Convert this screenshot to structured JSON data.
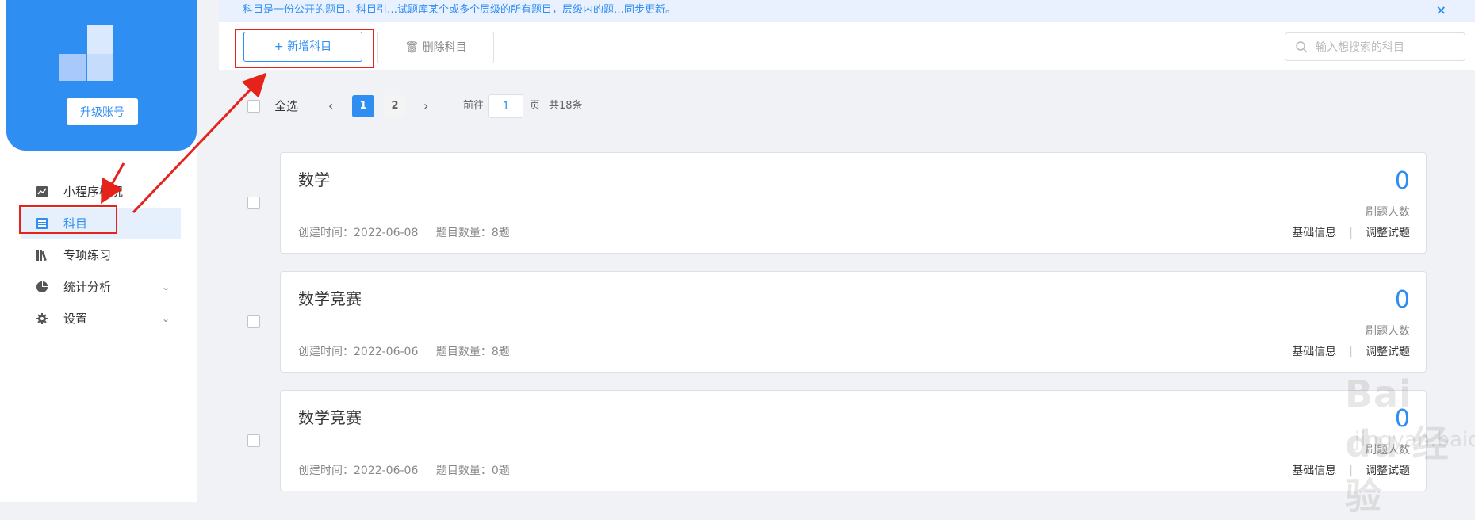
{
  "sidebar": {
    "upgrade_label": "升级账号",
    "menu": [
      {
        "label": "小程序概况",
        "icon": "trend-chart-icon"
      },
      {
        "label": "科目",
        "icon": "list-icon"
      },
      {
        "label": "专项练习",
        "icon": "books-icon"
      },
      {
        "label": "统计分析",
        "icon": "pie-chart-icon"
      },
      {
        "label": "设置",
        "icon": "gear-icon"
      }
    ]
  },
  "notice": {
    "text": "科目是一份公开的题目。科目引…试题库某个或多个层级的所有题目，层级内的题…同步更新。",
    "close": "×"
  },
  "toolbar": {
    "add_label": "+ 新增科目",
    "delete_label": "删除科目",
    "search_placeholder": "输入想搜索的科目"
  },
  "pagination": {
    "select_all": "全选",
    "prev": "‹",
    "pages": [
      "1",
      "2"
    ],
    "current_page": "1",
    "next": "›",
    "goto_label": "前往",
    "goto_value": "1",
    "page_word": "页",
    "total": "共18条"
  },
  "subjects": [
    {
      "title": "数学",
      "created": "创建时间：2022-06-08",
      "question_count": "题目数量：8题",
      "count": "0",
      "count_label": "刷题人数",
      "link_info": "基础信息",
      "link_adjust": "调整试题"
    },
    {
      "title": "数学竞赛",
      "created": "创建时间：2022-06-06",
      "question_count": "题目数量：8题",
      "count": "0",
      "count_label": "刷题人数",
      "link_info": "基础信息",
      "link_adjust": "调整试题"
    },
    {
      "title": "数学竞赛",
      "created": "创建时间：2022-06-06",
      "question_count": "题目数量：0题",
      "count": "0",
      "count_label": "刷题人数",
      "link_info": "基础信息",
      "link_adjust": "调整试题"
    }
  ],
  "watermark": {
    "main": "Bai du 经验",
    "sub": "jingyan.baidu.com"
  },
  "colors": {
    "accent": "#2f8ef2",
    "annotation": "#e5231a",
    "background": "#f0f2f5"
  }
}
